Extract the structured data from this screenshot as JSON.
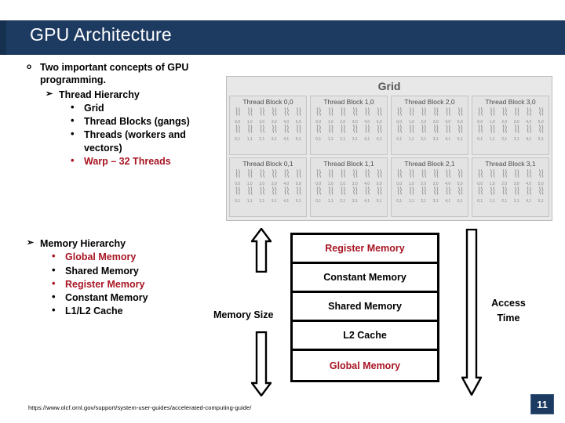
{
  "slide": {
    "title": "GPU Architecture",
    "page_number": "11",
    "footer_url": "https://www.olcf.ornl.gov/support/system-user-guides/accelerated-computing-guide/",
    "title_band_color": "#1d3a61",
    "accent_red": "#a81523"
  },
  "bullets": {
    "intro": {
      "marker": "o",
      "text": "Two important concepts of GPU programming."
    },
    "thread_hierarchy": {
      "marker": "➢",
      "text": "Thread Hierarchy",
      "items": [
        {
          "marker": "•",
          "text": "Grid",
          "red": false
        },
        {
          "marker": "•",
          "text": "Thread Blocks (gangs)",
          "red": false
        },
        {
          "marker": "•",
          "text": "Threads (workers and vectors)",
          "red": false
        },
        {
          "marker": "•",
          "text": "Warp – 32 Threads",
          "red": true
        }
      ]
    },
    "memory_hierarchy": {
      "marker": "➢",
      "text": "Memory Hierarchy",
      "items": [
        {
          "marker": "•",
          "text": "Global Memory",
          "red": true
        },
        {
          "marker": "•",
          "text": "Shared Memory",
          "red": false
        },
        {
          "marker": "•",
          "text": "Register Memory",
          "red": true
        },
        {
          "marker": "•",
          "text": "Constant Memory",
          "red": false
        },
        {
          "marker": "•",
          "text": "L1/L2 Cache",
          "red": false
        }
      ]
    }
  },
  "grid_figure": {
    "title": "Grid",
    "rows": [
      [
        {
          "title": "Thread Block 0,0"
        },
        {
          "title": "Thread Block 1,0"
        },
        {
          "title": "Thread Block 2,0"
        },
        {
          "title": "Thread Block 3,0"
        }
      ],
      [
        {
          "title": "Thread Block 0,1"
        },
        {
          "title": "Thread Block 1,1"
        },
        {
          "title": "Thread Block 2,1"
        },
        {
          "title": "Thread Block 3,1"
        }
      ]
    ],
    "thread_coords_row0": [
      "0,0",
      "1,0",
      "2,0",
      "3,0",
      "4,0",
      "5,0"
    ],
    "thread_coords_row1": [
      "0,1",
      "1,1",
      "2,1",
      "3,1",
      "4,1",
      "5,1"
    ]
  },
  "memory_diagram": {
    "left_label": "Memory Size",
    "right_label_line1": "Access",
    "right_label_line2": "Time",
    "rows": [
      {
        "label": "Register Memory",
        "red": true
      },
      {
        "label": "Constant Memory",
        "red": false
      },
      {
        "label": "Shared Memory",
        "red": false
      },
      {
        "label": "L2 Cache",
        "red": false
      },
      {
        "label": "Global Memory",
        "red": true
      }
    ]
  }
}
